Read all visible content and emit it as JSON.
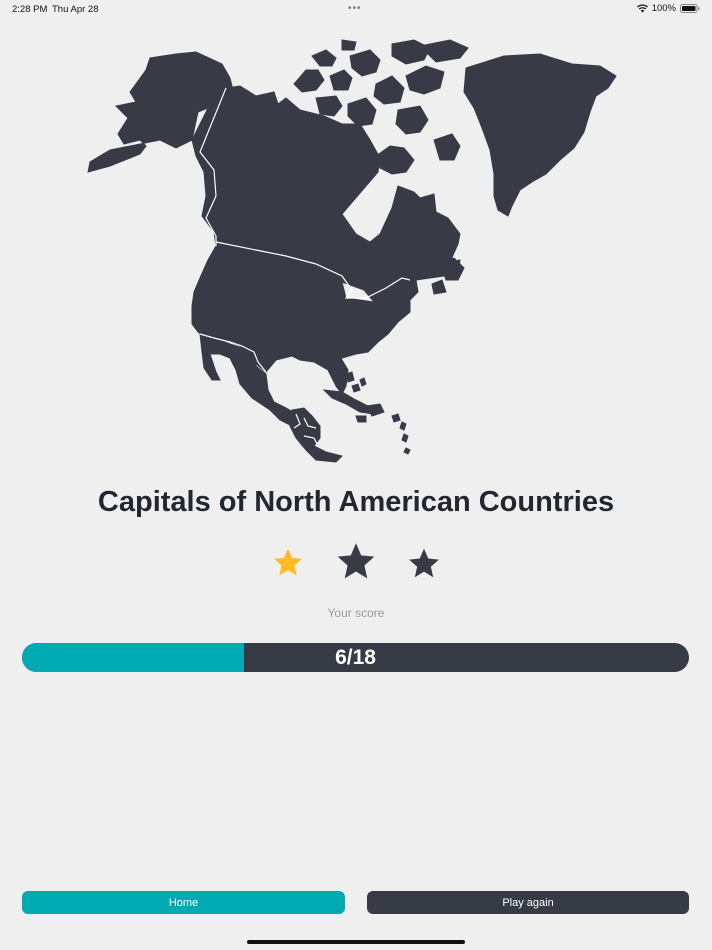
{
  "status_bar": {
    "time": "2:28 PM",
    "date": "Thu Apr 28",
    "multitask": "•••",
    "battery": "100%"
  },
  "quiz": {
    "title": "Capitals of North American Countries",
    "score_label": "Your score",
    "score_text": "6/18",
    "score_value": 6,
    "score_total": 18
  },
  "rating": {
    "stars_total": 3,
    "stars_earned": 1
  },
  "buttons": {
    "home": "Home",
    "play_again": "Play again"
  },
  "colors": {
    "accent": "#00aab3",
    "dark": "#373b45",
    "star_gold": "#ffba26",
    "background": "#efefef"
  },
  "icons": {
    "map": "north-america-map",
    "wifi": "wifi-icon",
    "battery": "battery-icon",
    "star": "star-icon"
  }
}
